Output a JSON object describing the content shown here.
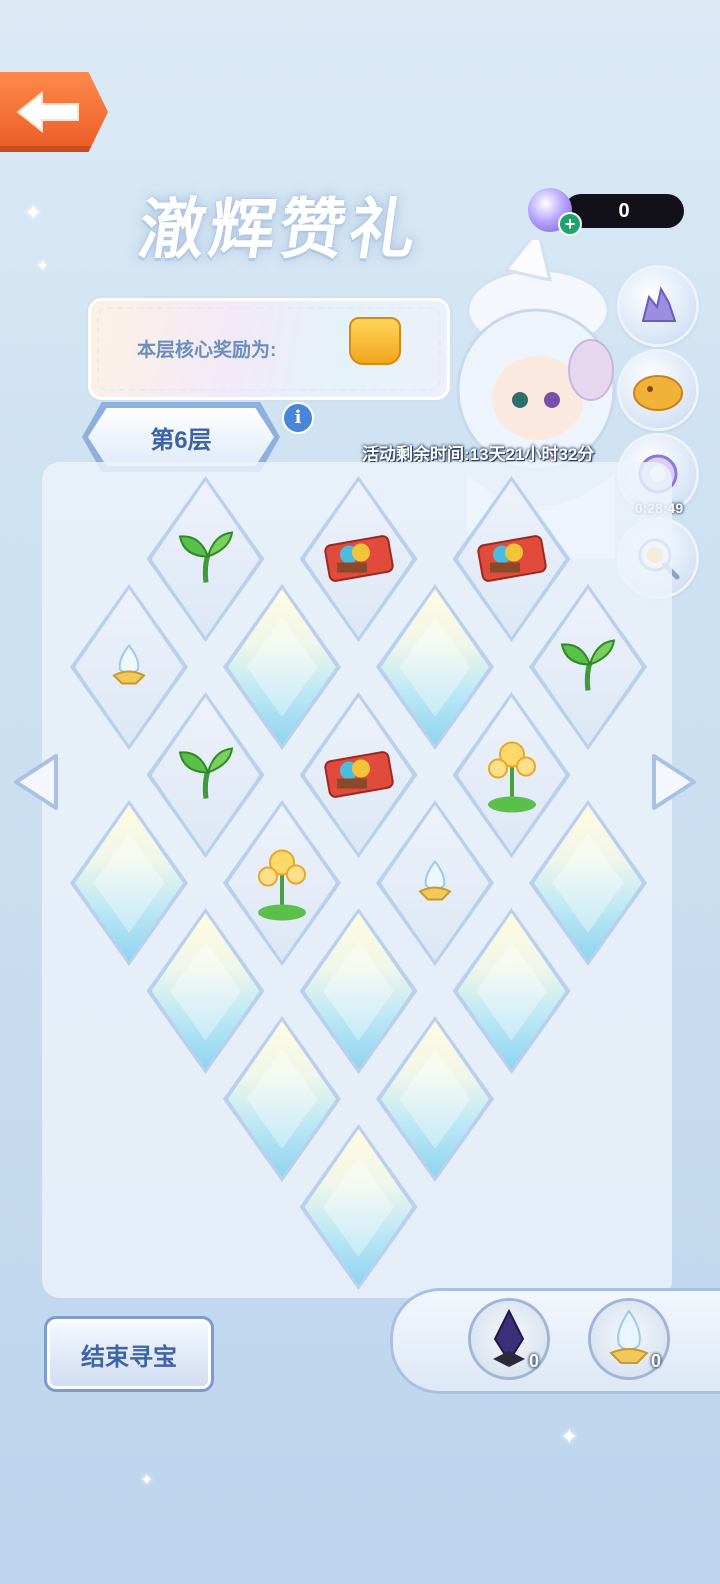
{
  "title": "澈辉赞礼",
  "currency": {
    "value": "0"
  },
  "reward_banner": {
    "label": "本层核心奖励为:"
  },
  "layer": {
    "label": "第6层"
  },
  "timer": {
    "text": "活动剩余时间:13天21小时32分"
  },
  "side_icons": [
    {
      "name": "crystal-cluster-icon"
    },
    {
      "name": "golden-mascot-icon"
    },
    {
      "name": "gem-pack-icon",
      "timer": "0:28:49"
    },
    {
      "name": "magnifier-duck-icon"
    }
  ],
  "board": {
    "tiles": [
      {
        "row": 0,
        "col": 1,
        "state": "open",
        "item": "sprout"
      },
      {
        "row": 0,
        "col": 3,
        "state": "open",
        "item": "ticket"
      },
      {
        "row": 0,
        "col": 5,
        "state": "open",
        "item": "ticket"
      },
      {
        "row": 1,
        "col": 0,
        "state": "open",
        "item": "egg"
      },
      {
        "row": 1,
        "col": 2,
        "state": "closed"
      },
      {
        "row": 1,
        "col": 4,
        "state": "closed"
      },
      {
        "row": 1,
        "col": 6,
        "state": "open",
        "item": "sprout"
      },
      {
        "row": 2,
        "col": 1,
        "state": "open",
        "item": "sprout"
      },
      {
        "row": 2,
        "col": 3,
        "state": "open",
        "item": "ticket"
      },
      {
        "row": 2,
        "col": 5,
        "state": "open",
        "item": "flower"
      },
      {
        "row": 3,
        "col": 0,
        "state": "closed"
      },
      {
        "row": 3,
        "col": 2,
        "state": "open",
        "item": "flower"
      },
      {
        "row": 3,
        "col": 4,
        "state": "open",
        "item": "egg"
      },
      {
        "row": 3,
        "col": 6,
        "state": "closed"
      },
      {
        "row": 4,
        "col": 1,
        "state": "closed"
      },
      {
        "row": 4,
        "col": 3,
        "state": "closed"
      },
      {
        "row": 4,
        "col": 5,
        "state": "closed"
      },
      {
        "row": 5,
        "col": 2,
        "state": "closed"
      },
      {
        "row": 5,
        "col": 4,
        "state": "closed"
      },
      {
        "row": 6,
        "col": 3,
        "state": "closed"
      }
    ]
  },
  "end_button": {
    "label": "结束寻宝"
  },
  "inventory": [
    {
      "name": "dark-crystal-icon",
      "count": "0"
    },
    {
      "name": "light-crystal-icon",
      "count": "0"
    }
  ]
}
